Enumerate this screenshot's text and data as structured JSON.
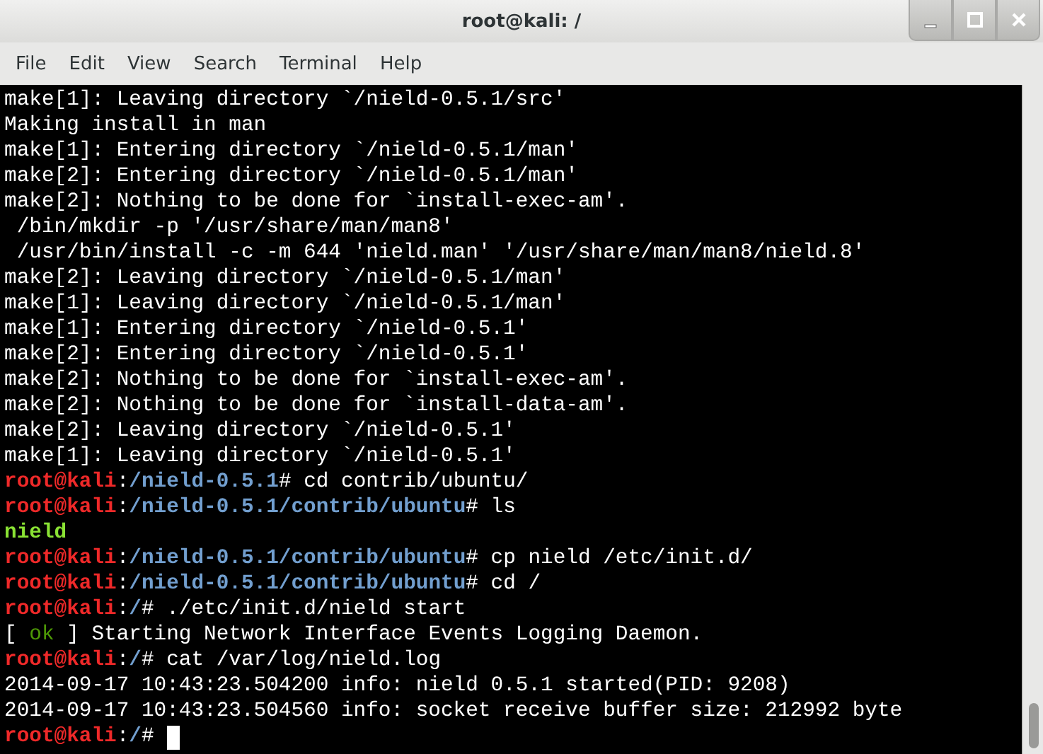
{
  "window": {
    "title": "root@kali: /"
  },
  "menu": [
    "File",
    "Edit",
    "View",
    "Search",
    "Terminal",
    "Help"
  ],
  "terminal": {
    "lines": [
      [
        {
          "kind": "plain",
          "text": "make[1]: Leaving directory `/nield-0.5.1/src'"
        }
      ],
      [
        {
          "kind": "plain",
          "text": "Making install in man"
        }
      ],
      [
        {
          "kind": "plain",
          "text": "make[1]: Entering directory `/nield-0.5.1/man'"
        }
      ],
      [
        {
          "kind": "plain",
          "text": "make[2]: Entering directory `/nield-0.5.1/man'"
        }
      ],
      [
        {
          "kind": "plain",
          "text": "make[2]: Nothing to be done for `install-exec-am'."
        }
      ],
      [
        {
          "kind": "plain",
          "text": " /bin/mkdir -p '/usr/share/man/man8'"
        }
      ],
      [
        {
          "kind": "plain",
          "text": " /usr/bin/install -c -m 644 'nield.man' '/usr/share/man/man8/nield.8'"
        }
      ],
      [
        {
          "kind": "plain",
          "text": "make[2]: Leaving directory `/nield-0.5.1/man'"
        }
      ],
      [
        {
          "kind": "plain",
          "text": "make[1]: Leaving directory `/nield-0.5.1/man'"
        }
      ],
      [
        {
          "kind": "plain",
          "text": "make[1]: Entering directory `/nield-0.5.1'"
        }
      ],
      [
        {
          "kind": "plain",
          "text": "make[2]: Entering directory `/nield-0.5.1'"
        }
      ],
      [
        {
          "kind": "plain",
          "text": "make[2]: Nothing to be done for `install-exec-am'."
        }
      ],
      [
        {
          "kind": "plain",
          "text": "make[2]: Nothing to be done for `install-data-am'."
        }
      ],
      [
        {
          "kind": "plain",
          "text": "make[2]: Leaving directory `/nield-0.5.1'"
        }
      ],
      [
        {
          "kind": "plain",
          "text": "make[1]: Leaving directory `/nield-0.5.1'"
        }
      ],
      [
        {
          "kind": "user",
          "text": "root@kali"
        },
        {
          "kind": "plain",
          "text": ":"
        },
        {
          "kind": "path",
          "text": "/nield-0.5.1"
        },
        {
          "kind": "plain",
          "text": "# cd contrib/ubuntu/"
        }
      ],
      [
        {
          "kind": "user",
          "text": "root@kali"
        },
        {
          "kind": "plain",
          "text": ":"
        },
        {
          "kind": "path",
          "text": "/nield-0.5.1/contrib/ubuntu"
        },
        {
          "kind": "plain",
          "text": "# ls"
        }
      ],
      [
        {
          "kind": "exec",
          "text": "nield"
        }
      ],
      [
        {
          "kind": "user",
          "text": "root@kali"
        },
        {
          "kind": "plain",
          "text": ":"
        },
        {
          "kind": "path",
          "text": "/nield-0.5.1/contrib/ubuntu"
        },
        {
          "kind": "plain",
          "text": "# cp nield /etc/init.d/"
        }
      ],
      [
        {
          "kind": "user",
          "text": "root@kali"
        },
        {
          "kind": "plain",
          "text": ":"
        },
        {
          "kind": "path",
          "text": "/nield-0.5.1/contrib/ubuntu"
        },
        {
          "kind": "plain",
          "text": "# cd /"
        }
      ],
      [
        {
          "kind": "user",
          "text": "root@kali"
        },
        {
          "kind": "plain",
          "text": ":"
        },
        {
          "kind": "path",
          "text": "/"
        },
        {
          "kind": "plain",
          "text": "# ./etc/init.d/nield start"
        }
      ],
      [
        {
          "kind": "plain",
          "text": "[ "
        },
        {
          "kind": "ok",
          "text": "ok"
        },
        {
          "kind": "plain",
          "text": " ] Starting Network Interface Events Logging Daemon."
        }
      ],
      [
        {
          "kind": "user",
          "text": "root@kali"
        },
        {
          "kind": "plain",
          "text": ":"
        },
        {
          "kind": "path",
          "text": "/"
        },
        {
          "kind": "plain",
          "text": "# cat /var/log/nield.log"
        }
      ],
      [
        {
          "kind": "plain",
          "text": "2014-09-17 10:43:23.504200 info: nield 0.5.1 started(PID: 9208)"
        }
      ],
      [
        {
          "kind": "plain",
          "text": "2014-09-17 10:43:23.504560 info: socket receive buffer size: 212992 byte"
        }
      ],
      [
        {
          "kind": "user",
          "text": "root@kali"
        },
        {
          "kind": "plain",
          "text": ":"
        },
        {
          "kind": "path",
          "text": "/"
        },
        {
          "kind": "plain",
          "text": "# "
        }
      ]
    ]
  }
}
